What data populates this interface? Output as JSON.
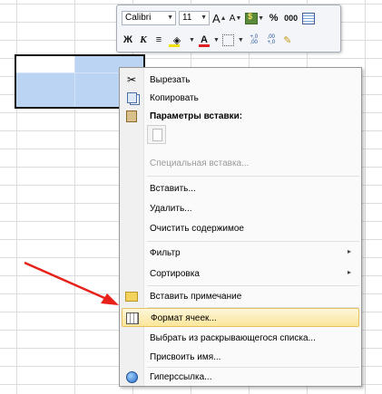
{
  "mini_toolbar": {
    "font_name": "Calibri",
    "font_size": "11",
    "grow_label": "A",
    "shrink_label": "A",
    "currency_label": "$",
    "percent_label": "%",
    "thousands_label": "000",
    "bold_label": "Ж",
    "italic_label": "К",
    "font_color_label": "A",
    "font_color_hex": "#e02020",
    "fill_color_hex": "#f2e100",
    "inc_decimal_label": "+,0\n,00",
    "dec_decimal_label": ",00\n+,0"
  },
  "context_menu": {
    "items": [
      {
        "label": "Вырезать",
        "icon": "scissors-icon"
      },
      {
        "label": "Копировать",
        "icon": "copy-icon"
      },
      {
        "label": "Параметры вставки:",
        "icon": "paste-options-icon"
      },
      {
        "label": "Специальная вставка..."
      },
      {
        "label": "Вставить..."
      },
      {
        "label": "Удалить..."
      },
      {
        "label": "Очистить содержимое"
      },
      {
        "label": "Фильтр",
        "submenu": "▸"
      },
      {
        "label": "Сортировка",
        "submenu": "▸"
      },
      {
        "label": "Вставить примечание",
        "icon": "comment-icon"
      },
      {
        "label": "Формат ячеек...",
        "icon": "format-cells-icon"
      },
      {
        "label": "Выбрать из раскрывающегося списка..."
      },
      {
        "label": "Присвоить имя..."
      },
      {
        "label": "Гиперссылка...",
        "icon": "hyperlink-icon"
      }
    ]
  },
  "colors": {
    "arrow": "#e8201a",
    "selection": "#bcd4f4",
    "highlight": "#fbe69a"
  }
}
